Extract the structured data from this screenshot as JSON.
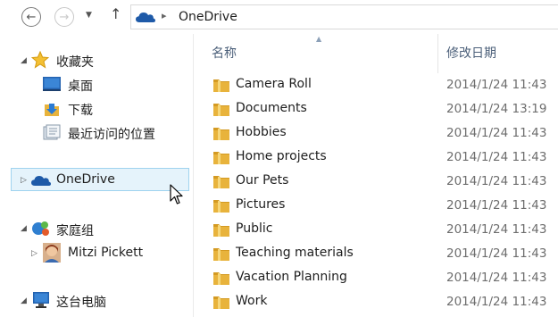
{
  "address_bar": {
    "location": "OneDrive"
  },
  "nav_pane": {
    "favorites": {
      "label": "收藏夹",
      "items": [
        {
          "label": "桌面",
          "icon": "desktop-icon"
        },
        {
          "label": "下载",
          "icon": "download-icon"
        },
        {
          "label": "最近访问的位置",
          "icon": "recent-places-icon"
        }
      ]
    },
    "onedrive": {
      "label": "OneDrive",
      "selected": true
    },
    "homegroup": {
      "label": "家庭组",
      "items": [
        {
          "label": "Mitzi Pickett",
          "icon": "user-avatar-icon"
        }
      ]
    },
    "this_pc": {
      "label": "这台电脑"
    }
  },
  "content": {
    "columns": {
      "name": "名称",
      "date_modified": "修改日期"
    },
    "sort_column": "name",
    "files": [
      {
        "name": "Camera Roll",
        "date": "2014/1/24 11:43"
      },
      {
        "name": "Documents",
        "date": "2014/1/24 13:19"
      },
      {
        "name": "Hobbies",
        "date": "2014/1/24 11:43"
      },
      {
        "name": "Home projects",
        "date": "2014/1/24 11:43"
      },
      {
        "name": "Our Pets",
        "date": "2014/1/24 11:43"
      },
      {
        "name": "Pictures",
        "date": "2014/1/24 11:43"
      },
      {
        "name": "Public",
        "date": "2014/1/24 11:43"
      },
      {
        "name": "Teaching materials",
        "date": "2014/1/24 11:43"
      },
      {
        "name": "Vacation Planning",
        "date": "2014/1/24 11:43"
      },
      {
        "name": "Work",
        "date": "2014/1/24 11:43"
      }
    ]
  },
  "colors": {
    "selection_fill": "#e5f3fb",
    "selection_border": "#9fd3ef",
    "header_text": "#4c607a",
    "date_text": "#6d6d6d",
    "folder": "#e8b33c",
    "onedrive_blue": "#1e5aa8"
  }
}
